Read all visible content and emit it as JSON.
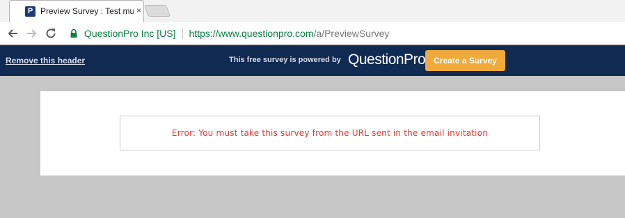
{
  "browser": {
    "tab": {
      "title": "Preview Survey : Test mul",
      "close_glyph": "×",
      "favicon_letter": "P"
    },
    "toolbar": {
      "secure_label": "QuestionPro Inc [US]",
      "url_host": "https://www.questionpro.com",
      "url_path": "/a/PreviewSurvey"
    }
  },
  "header": {
    "remove_link": "Remove this header",
    "powered_by": "This free survey is powered by",
    "logo_text": "QuestionPro",
    "create_button": "Create a Survey"
  },
  "main": {
    "error_message": "Error: You must take this survey from the URL sent in the email invitation"
  },
  "colors": {
    "header_bg": "#102a52",
    "create_button_bg": "#f0a93b",
    "error_text": "#e53935",
    "secure_green": "#0b8043",
    "page_bg": "#c6c6c6"
  },
  "icons": [
    "favicon-icon",
    "close-icon",
    "back-arrow-icon",
    "forward-arrow-icon",
    "reload-icon",
    "lock-icon"
  ]
}
